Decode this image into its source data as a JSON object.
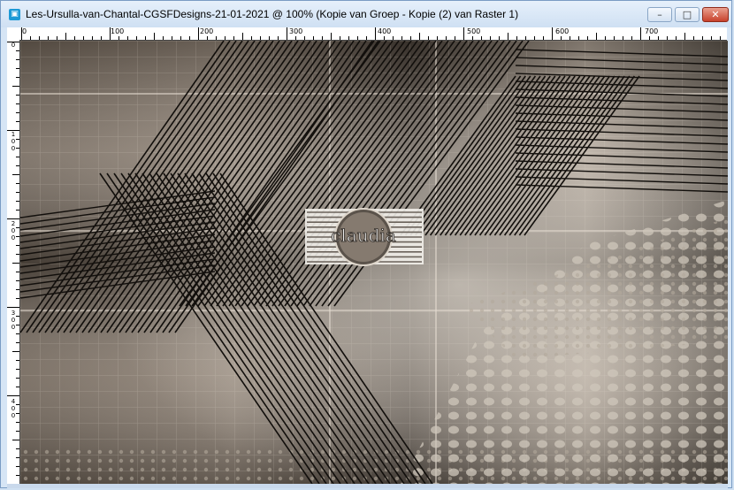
{
  "window": {
    "title": "Les-Ursulla-van-Chantal-CGSFDesigns-21-01-2021 @ 100% (Kopie van Groep - Kopie (2) van Raster 1)",
    "app_icon": "psp-icon",
    "controls": {
      "minimize": "–",
      "maximize": "□",
      "close": "✕"
    }
  },
  "ruler_top": {
    "labels": [
      "0",
      "100",
      "200",
      "300",
      "400",
      "500",
      "600",
      "700"
    ]
  },
  "ruler_left": {
    "labels": [
      "0",
      "1\n0\n0",
      "2\n0\n0",
      "3\n0\n0",
      "4\n0\n0"
    ]
  },
  "canvas": {
    "logo_text": "claudia",
    "colors": {
      "bg": "#5e554b",
      "light": "#d8cfc4",
      "dark": "#1b1713"
    }
  }
}
